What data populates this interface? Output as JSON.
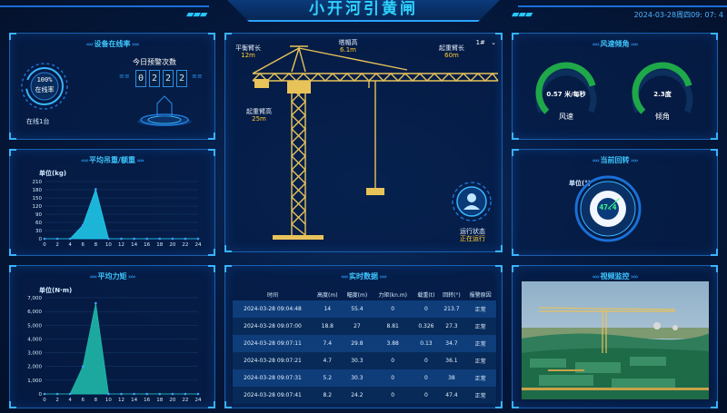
{
  "header": {
    "title": "小开河引黄闸",
    "datetime": "2024-03-28周四09: 07: 4"
  },
  "device_online": {
    "title": "设备在线率",
    "rate": "100%",
    "rate_label": "在线率",
    "online_count": "在线1台",
    "alarm_title": "今日预警次数",
    "alarm_digits": [
      "0",
      "2",
      "2",
      "2"
    ]
  },
  "crane": {
    "selector": "1#",
    "jib_balance_label": "平衡臂长",
    "jib_balance_value": "12m",
    "tower_top_label": "塔帽高",
    "tower_top_value": "6.1m",
    "jib_length_label": "起重臂长",
    "jib_length_value": "60m",
    "height_label": "起重臂高",
    "height_value": "25m",
    "status_label": "运行状态",
    "status_value": "正在运行"
  },
  "wind": {
    "title": "风速倾角",
    "speed_value": "0.57 米/每秒",
    "speed_label": "风速",
    "tilt_value": "2.3度",
    "tilt_label": "倾角",
    "speed_fraction": 0.78,
    "tilt_fraction": 0.78
  },
  "avg_weight": {
    "title": "平均吊重/额重",
    "unit": "单位(kg)",
    "chart_data": {
      "type": "area",
      "x": [
        0,
        2,
        4,
        6,
        8,
        10,
        12,
        14,
        16,
        18,
        20,
        22,
        24
      ],
      "values": [
        0,
        0,
        0,
        50,
        182,
        0,
        0,
        0,
        0,
        0,
        0,
        0,
        0
      ],
      "yticks": [
        0,
        30,
        60,
        90,
        120,
        150,
        180,
        210
      ],
      "ylim": [
        0,
        210
      ],
      "xlim": [
        0,
        24
      ],
      "xticks": [
        "0",
        "2",
        "4",
        "6",
        "8",
        "10",
        "12",
        "14",
        "16",
        "18",
        "20",
        "22",
        "24"
      ],
      "ylabel": "单位(kg)",
      "color": "#1fc6e8"
    }
  },
  "avg_torque": {
    "title": "平均力矩",
    "unit": "单位(N·m)",
    "chart_data": {
      "type": "area",
      "x": [
        0,
        2,
        4,
        6,
        8,
        10,
        12,
        14,
        16,
        18,
        20,
        22,
        24
      ],
      "values": [
        0,
        0,
        0,
        2000,
        6600,
        0,
        0,
        0,
        0,
        0,
        0,
        0,
        0
      ],
      "yticks": [
        0,
        1000,
        2000,
        3000,
        4000,
        5000,
        6000,
        7000
      ],
      "ytick_labels": [
        "0",
        "1,000",
        "2,000",
        "3,000",
        "4,000",
        "5,000",
        "6,000",
        "7,000"
      ],
      "ylim": [
        0,
        7000
      ],
      "xlim": [
        0,
        24
      ],
      "xticks": [
        "0",
        "2",
        "4",
        "6",
        "8",
        "10",
        "12",
        "14",
        "16",
        "18",
        "20",
        "22",
        "24"
      ],
      "ylabel": "单位(N·m)",
      "color": "#1fb8a8"
    }
  },
  "rotation": {
    "title": "当前回转",
    "unit": "单位(°)",
    "value": "47.4",
    "ticks": [
      "0",
      "30",
      "60",
      "90",
      "120",
      "150",
      "180",
      "210",
      "240",
      "270",
      "300",
      "330"
    ]
  },
  "realtime": {
    "title": "实时数据",
    "columns": [
      "时间",
      "高度(m)",
      "幅度(m)",
      "力矩(kn.m)",
      "载重(t)",
      "回转(°)",
      "报警原因"
    ],
    "rows": [
      [
        "2024-03-28 09:04:48",
        "14",
        "55.4",
        "0",
        "0",
        "213.7",
        "正常"
      ],
      [
        "2024-03-28 09:07:00",
        "18.8",
        "27",
        "8.81",
        "0.326",
        "27.3",
        "正常"
      ],
      [
        "2024-03-28 09:07:11",
        "7.4",
        "29.8",
        "3.88",
        "0.13",
        "34.7",
        "正常"
      ],
      [
        "2024-03-28 09:07:21",
        "4.7",
        "30.3",
        "0",
        "0",
        "36.1",
        "正常"
      ],
      [
        "2024-03-28 09:07:31",
        "5.2",
        "30.3",
        "0",
        "0",
        "38",
        "正常"
      ],
      [
        "2024-03-28 09:07:41",
        "8.2",
        "24.2",
        "0",
        "0",
        "47.4",
        "正常"
      ]
    ]
  },
  "camera": {
    "title": "视频监控"
  }
}
